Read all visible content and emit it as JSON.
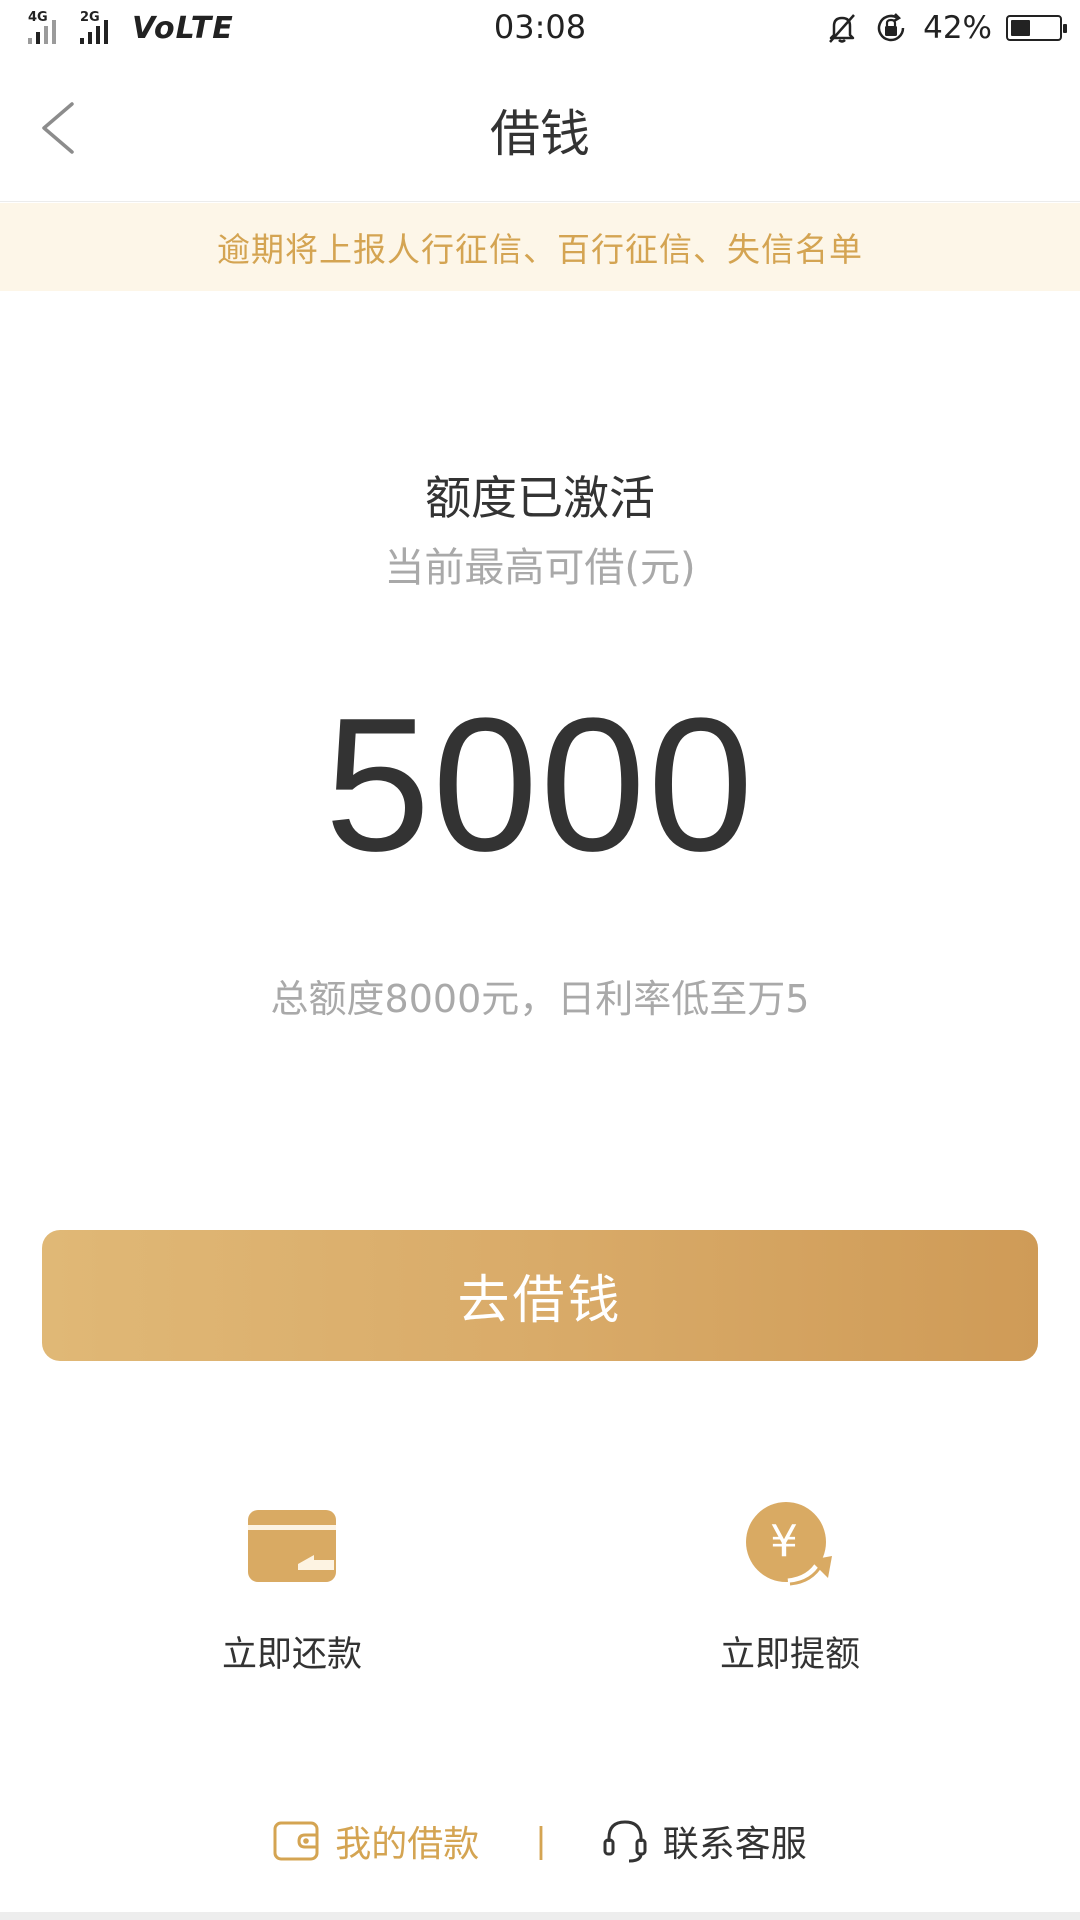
{
  "status_bar": {
    "network_1": "4G",
    "network_2": "2G",
    "volte": "VoLTE",
    "time": "03:08",
    "battery_percent": "42%",
    "battery_level": 0.42,
    "icons": [
      "silent-bell-icon",
      "rotation-lock-icon",
      "battery-icon"
    ]
  },
  "nav": {
    "title": "借钱",
    "back_icon": "chevron-left-icon"
  },
  "notice": {
    "text": "逾期将上报人行征信、百行征信、失信名单",
    "color": "#d4a452",
    "background": "#fdf6e8"
  },
  "quota": {
    "status": "额度已激活",
    "subtitle": "当前最高可借(元)",
    "amount": "5000",
    "total_info": "总额度8000元，日利率低至万5"
  },
  "borrow_button": {
    "label": "去借钱",
    "gradient": [
      "#e0b876",
      "#cf9b57"
    ]
  },
  "actions": [
    {
      "label": "立即还款",
      "icon": "card-repay-icon"
    },
    {
      "label": "立即提额",
      "icon": "yuan-increase-icon"
    }
  ],
  "footer": {
    "my_loans": "我的借款",
    "my_loans_icon": "wallet-icon",
    "separator": "|",
    "service": "联系客服",
    "service_icon": "headset-icon"
  },
  "colors": {
    "accent": "#d4a452",
    "text_primary": "#333333",
    "text_secondary": "#a9a9a9"
  }
}
